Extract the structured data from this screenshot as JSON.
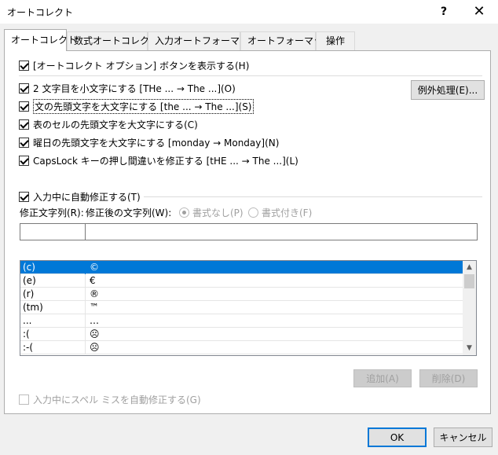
{
  "window": {
    "title": "オートコレクト",
    "help_glyph": "?",
    "close_glyph": "✕"
  },
  "tabs": [
    {
      "label": "オートコレクト",
      "active": true
    },
    {
      "label": "数式オートコレクト",
      "active": false
    },
    {
      "label": "入力オートフォーマット",
      "active": false
    },
    {
      "label": "オートフォーマット",
      "active": false
    },
    {
      "label": "操作",
      "active": false
    }
  ],
  "options": {
    "show_buttons": "[オートコレクト オプション] ボタンを表示する(H)",
    "two_initial_caps": "2 文字目を小文字にする [THe ... → The ...](O)",
    "capitalize_sentences": "文の先頭文字を大文字にする [the ... → The ...](S)",
    "capitalize_table_cells": "表のセルの先頭文字を大文字にする(C)",
    "capitalize_days": "曜日の先頭文字を大文字にする [monday →  Monday](N)",
    "caps_lock": "CapsLock キーの押し間違いを修正する [tHE ... → The ...](L)"
  },
  "exceptions_button": "例外処理(E)...",
  "replace": {
    "checkbox_label": "入力中に自動修正する(T)",
    "replace_label": "修正文字列(R):",
    "with_label": "修正後の文字列(W):",
    "plain_text": "書式なし(P)",
    "formatted_text": "書式付き(F)",
    "replace_value": "",
    "with_value": ""
  },
  "entries": [
    {
      "from": "(c)",
      "to": "©"
    },
    {
      "from": "(e)",
      "to": "€"
    },
    {
      "from": "(r)",
      "to": "®"
    },
    {
      "from": "(tm)",
      "to": "™"
    },
    {
      "from": "...",
      "to": "…"
    },
    {
      "from": ":(",
      "to": "☹"
    },
    {
      "from": ":-(",
      "to": "☹"
    }
  ],
  "add_button": "追加(A)",
  "delete_button": "削除(D)",
  "spelling_checkbox": "入力中にスペル ミスを自動修正する(G)",
  "ok_button": "OK",
  "cancel_button": "キャンセル",
  "colors": {
    "selection": "#0078d7",
    "default_button_border": "#0078d7"
  },
  "icons": {
    "scroll_up": "chevron-up-icon",
    "scroll_down": "chevron-down-icon"
  }
}
